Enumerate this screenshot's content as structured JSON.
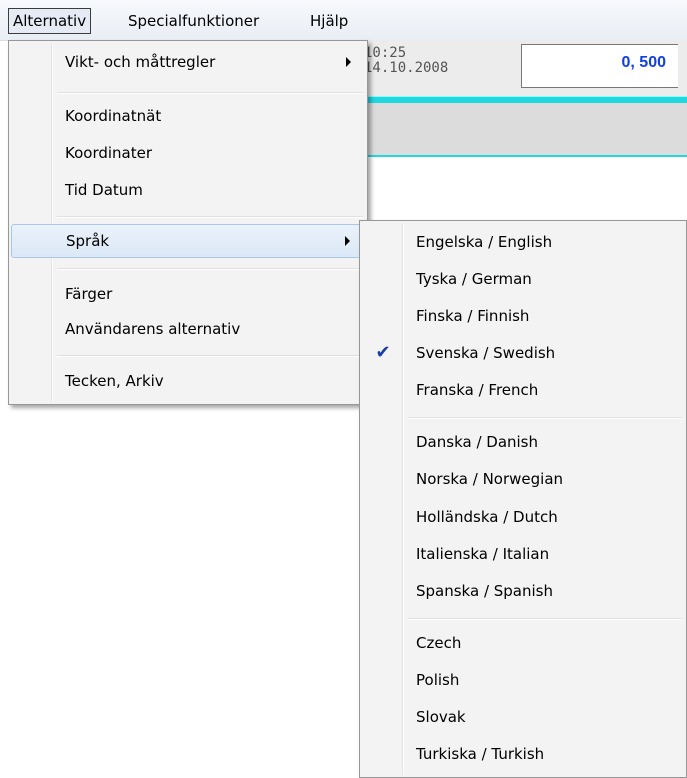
{
  "menubar": {
    "items": [
      {
        "label": "Alternativ"
      },
      {
        "label": "Specialfunktioner"
      },
      {
        "label": "Hjälp"
      }
    ]
  },
  "app": {
    "time": "10:25",
    "date": "14.10.2008",
    "value": "0, 500"
  },
  "alternativ_menu": {
    "items": [
      {
        "label": "Vikt- och måttregler"
      },
      {
        "label": "Koordinatnät"
      },
      {
        "label": "Koordinater"
      },
      {
        "label": "Tid  Datum"
      },
      {
        "label": "Språk"
      },
      {
        "label": "Färger"
      },
      {
        "label": "Användarens alternativ"
      },
      {
        "label": "Tecken, Arkiv"
      }
    ]
  },
  "language_menu": {
    "items": [
      {
        "label": "Engelska / English"
      },
      {
        "label": "Tyska / German"
      },
      {
        "label": "Finska / Finnish"
      },
      {
        "label": "Svenska / Swedish",
        "checked": true
      },
      {
        "label": "Franska / French"
      },
      {
        "label": "Danska / Danish"
      },
      {
        "label": "Norska / Norwegian"
      },
      {
        "label": "Holländska / Dutch"
      },
      {
        "label": "Italienska / Italian"
      },
      {
        "label": "Spanska / Spanish"
      },
      {
        "label": "Czech"
      },
      {
        "label": "Polish"
      },
      {
        "label": "Slovak"
      },
      {
        "label": "Turkiska / Turkish"
      }
    ],
    "check_icon": "checkmark-icon"
  }
}
